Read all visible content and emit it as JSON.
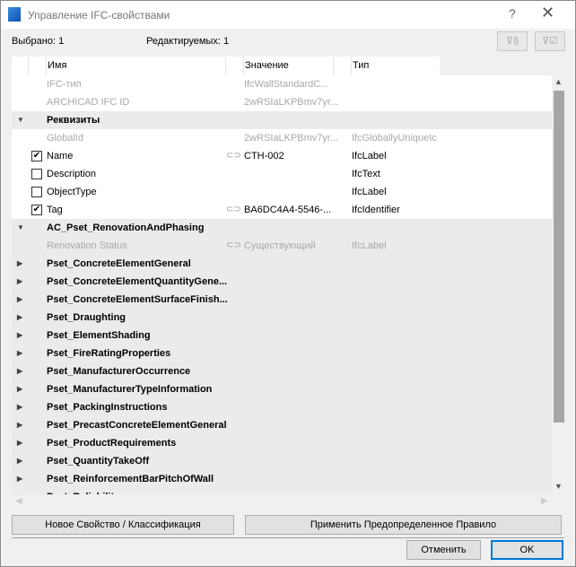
{
  "window": {
    "title": "Управление IFC-свойствами",
    "help": "?",
    "close": "✕"
  },
  "status": {
    "selected": "Выбрано: 1",
    "editable": "Редактируемых: 1"
  },
  "filters": [
    {
      "icon": "filter-property-icon",
      "label": "⊽§"
    },
    {
      "icon": "filter-checked-icon",
      "label": "⊽☑"
    }
  ],
  "columns": {
    "name": "Имя",
    "value": "Значение",
    "type": "Тип"
  },
  "rows": [
    {
      "kind": "info",
      "name": "IFC-тип",
      "value": "IfcWallStandardC...",
      "type": ""
    },
    {
      "kind": "info",
      "name": "ARCHICAD IFC ID",
      "value": "2wRSIaLKPBmv7yr...",
      "type": ""
    },
    {
      "kind": "group",
      "name": "Реквизиты",
      "expanded": true
    },
    {
      "kind": "info",
      "name": "GlobalId",
      "value": "2wRSIaLKPBmv7yr...",
      "type": "IfcGloballyUniqueIc"
    },
    {
      "kind": "prop",
      "checked": true,
      "name": "Name",
      "linked": true,
      "value": "CTH-002",
      "type": "IfcLabel"
    },
    {
      "kind": "prop",
      "checked": false,
      "name": "Description",
      "linked": false,
      "value": "",
      "type": "IfcText"
    },
    {
      "kind": "prop",
      "checked": false,
      "name": "ObjectType",
      "linked": false,
      "value": "",
      "type": "IfcLabel"
    },
    {
      "kind": "prop",
      "checked": true,
      "name": "Tag",
      "linked": true,
      "value": "BA6DC4A4-5546-...",
      "type": "IfcIdentifier"
    },
    {
      "kind": "group",
      "name": "AC_Pset_RenovationAndPhasing",
      "expanded": true
    },
    {
      "kind": "info",
      "name": "Renovation Status",
      "linked": true,
      "value": "Существующий",
      "type": "IfcLabel"
    },
    {
      "kind": "group",
      "name": "Pset_ConcreteElementGeneral",
      "expanded": false
    },
    {
      "kind": "group",
      "name": "Pset_ConcreteElementQuantityGene...",
      "expanded": false
    },
    {
      "kind": "group",
      "name": "Pset_ConcreteElementSurfaceFinish...",
      "expanded": false
    },
    {
      "kind": "group",
      "name": "Pset_Draughting",
      "expanded": false
    },
    {
      "kind": "group",
      "name": "Pset_ElementShading",
      "expanded": false
    },
    {
      "kind": "group",
      "name": "Pset_FireRatingProperties",
      "expanded": false
    },
    {
      "kind": "group",
      "name": "Pset_ManufacturerOccurrence",
      "expanded": false
    },
    {
      "kind": "group",
      "name": "Pset_ManufacturerTypeInformation",
      "expanded": false
    },
    {
      "kind": "group",
      "name": "Pset_PackingInstructions",
      "expanded": false
    },
    {
      "kind": "group",
      "name": "Pset_PrecastConcreteElementGeneral",
      "expanded": false
    },
    {
      "kind": "group",
      "name": "Pset_ProductRequirements",
      "expanded": false
    },
    {
      "kind": "group",
      "name": "Pset_QuantityTakeOff",
      "expanded": false
    },
    {
      "kind": "group",
      "name": "Pset_ReinforcementBarPitchOfWall",
      "expanded": false
    },
    {
      "kind": "group",
      "name": "Pset_Reliability",
      "expanded": false
    }
  ],
  "buttons": {
    "new_property": "Новое Свойство / Классификация",
    "apply_rule": "Применить Предопределенное Правило",
    "cancel": "Отменить",
    "ok": "OK"
  },
  "colors": {
    "ok_border": "#0078d7",
    "group_bg": "#ebebeb",
    "dim_text": "#a8a8a8"
  }
}
